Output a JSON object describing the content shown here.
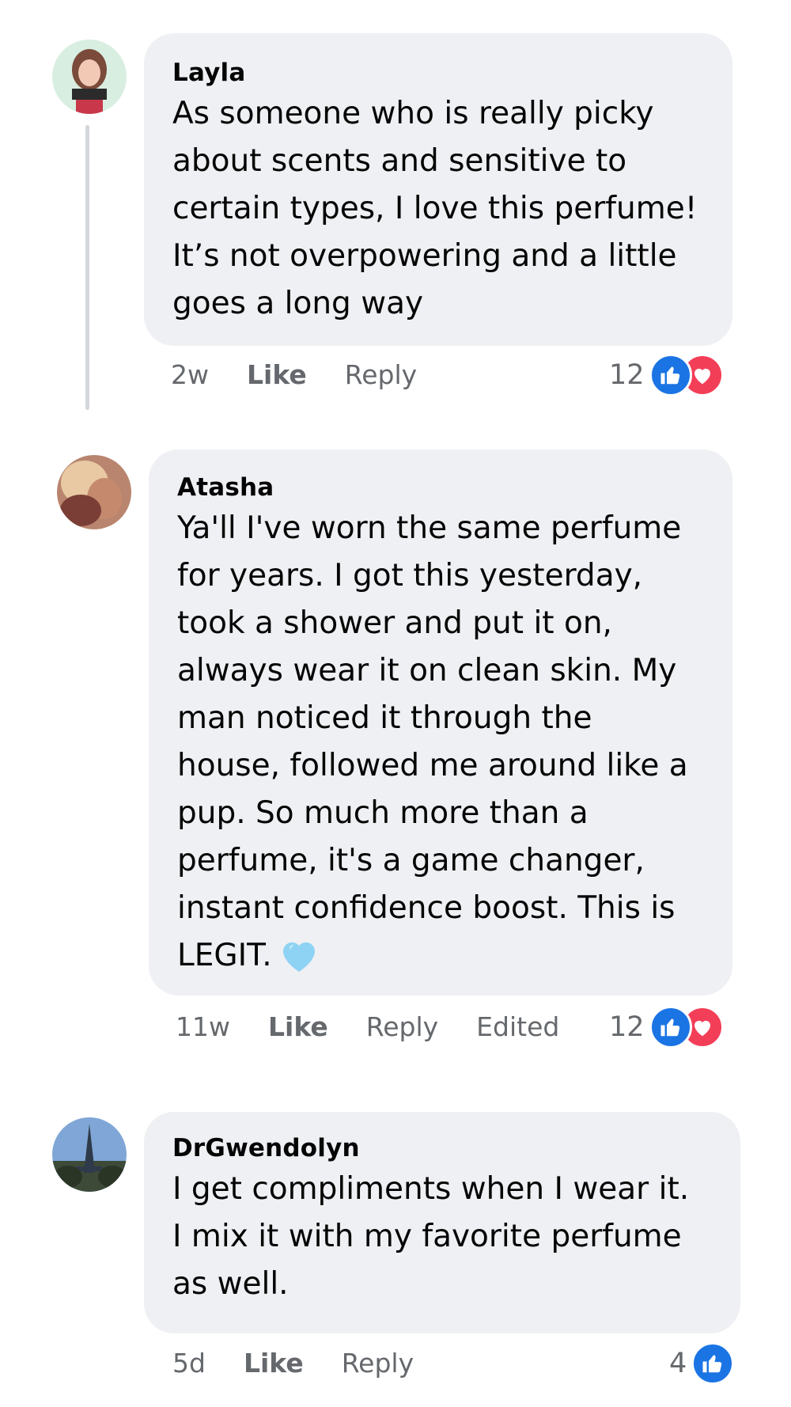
{
  "comments": [
    {
      "author": "Layla",
      "text": "As someone who is really picky\nabout scents and sensitive to\ncertain types, I love this perfume!\nIt’s not overpowering and a little\ngoes a long way",
      "time": "2w",
      "like_label": "Like",
      "reply_label": "Reply",
      "reaction_count": "12",
      "reactions": [
        "like-icon",
        "love-icon"
      ]
    },
    {
      "author": "Atasha",
      "text": "Ya'll I've worn the same perfume\nfor years. I got this yesterday,\ntook a shower and put it on,\nalways wear it on clean skin. My\nman noticed it through the\nhouse, followed me around like a\npup. So much more than a\nperfume, it's a game changer,\ninstant confidence boost. This is\nLEGIT.",
      "time": "11w",
      "like_label": "Like",
      "reply_label": "Reply",
      "edited_label": "Edited",
      "reaction_count": "12",
      "reactions": [
        "like-icon",
        "love-icon"
      ]
    },
    {
      "author": "DrGwendolyn",
      "text": "I get compliments when I wear it.\nI mix it with my favorite perfume\nas well.",
      "time": "5d",
      "like_label": "Like",
      "reply_label": "Reply",
      "reaction_count": "4",
      "reactions": [
        "like-icon"
      ]
    }
  ],
  "colors": {
    "bubble": "#eff0f3",
    "meta_text": "#65686c",
    "like_blue": "#1b74e4",
    "love_red": "#f33e58",
    "light_blue_heart": "#8fd3f4"
  }
}
